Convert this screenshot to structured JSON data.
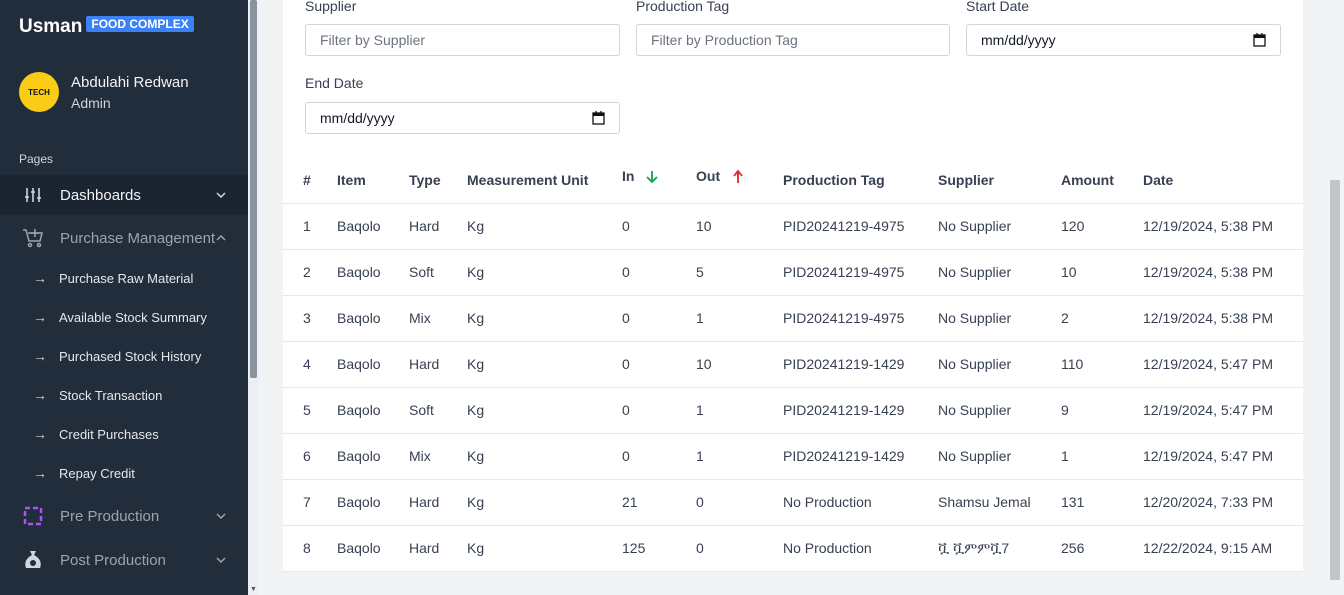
{
  "brand": {
    "name": "Usman",
    "badge": "FOOD COMPLEX"
  },
  "user": {
    "name": "Abdulahi Redwan",
    "role": "Admin",
    "avatar_text": "TECH"
  },
  "sidebar": {
    "pages_label": "Pages",
    "items": [
      {
        "label": "Dashboards",
        "icon": "sliders-icon"
      },
      {
        "label": "Purchase Management",
        "icon": "cart-plus-icon"
      },
      {
        "label": "Pre Production",
        "icon": "dashed-square-icon"
      },
      {
        "label": "Post Production",
        "icon": "money-bag-icon"
      }
    ],
    "sub_items": [
      {
        "label": "Purchase Raw Material"
      },
      {
        "label": "Available Stock Summary"
      },
      {
        "label": "Purchased Stock History"
      },
      {
        "label": "Stock Transaction"
      },
      {
        "label": "Credit Purchases"
      },
      {
        "label": "Repay Credit"
      }
    ],
    "sub_arrow": "→"
  },
  "filters": {
    "supplier": {
      "label": "Supplier",
      "placeholder": "Filter by Supplier"
    },
    "production_tag": {
      "label": "Production Tag",
      "placeholder": "Filter by Production Tag"
    },
    "start_date": {
      "label": "Start Date",
      "value": "mm/dd/yyyy"
    },
    "end_date": {
      "label": "End Date",
      "value": "mm/dd/yyyy"
    }
  },
  "table": {
    "headers": [
      "#",
      "Item",
      "Type",
      "Measurement Unit",
      "In",
      "Out",
      "Production Tag",
      "Supplier",
      "Amount",
      "Date"
    ],
    "rows": [
      [
        "1",
        "Baqolo",
        "Hard",
        "Kg",
        "0",
        "10",
        "PID20241219-4975",
        "No Supplier",
        "120",
        "12/19/2024, 5:38 PM"
      ],
      [
        "2",
        "Baqolo",
        "Soft",
        "Kg",
        "0",
        "5",
        "PID20241219-4975",
        "No Supplier",
        "10",
        "12/19/2024, 5:38 PM"
      ],
      [
        "3",
        "Baqolo",
        "Mix",
        "Kg",
        "0",
        "1",
        "PID20241219-4975",
        "No Supplier",
        "2",
        "12/19/2024, 5:38 PM"
      ],
      [
        "4",
        "Baqolo",
        "Hard",
        "Kg",
        "0",
        "10",
        "PID20241219-1429",
        "No Supplier",
        "110",
        "12/19/2024, 5:47 PM"
      ],
      [
        "5",
        "Baqolo",
        "Soft",
        "Kg",
        "0",
        "1",
        "PID20241219-1429",
        "No Supplier",
        "9",
        "12/19/2024, 5:47 PM"
      ],
      [
        "6",
        "Baqolo",
        "Mix",
        "Kg",
        "0",
        "1",
        "PID20241219-1429",
        "No Supplier",
        "1",
        "12/19/2024, 5:47 PM"
      ],
      [
        "7",
        "Baqolo",
        "Hard",
        "Kg",
        "21",
        "0",
        "No Production",
        "Shamsu Jemal",
        "131",
        "12/20/2024, 7:33 PM"
      ],
      [
        "8",
        "Baqolo",
        "Hard",
        "Kg",
        "125",
        "0",
        "No Production",
        "ቯ ቯምምቯ7",
        "256",
        "12/22/2024, 9:15 AM"
      ]
    ]
  },
  "colors": {
    "sidebar_bg": "#222d3b",
    "badge": "#3b82f6",
    "in_arrow": "#16a34a",
    "out_arrow": "#dc2626"
  }
}
